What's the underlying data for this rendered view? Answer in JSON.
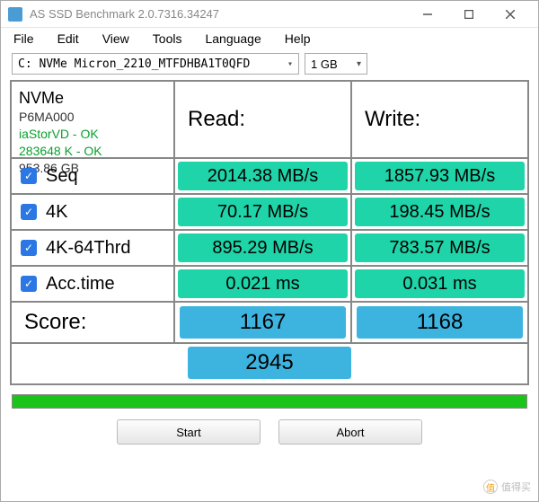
{
  "window": {
    "title": "AS SSD Benchmark 2.0.7316.34247"
  },
  "menu": {
    "file": "File",
    "edit": "Edit",
    "view": "View",
    "tools": "Tools",
    "language": "Language",
    "help": "Help"
  },
  "selectors": {
    "drive": "C: NVMe Micron_2210_MTFDHBA1T0QFD",
    "size": "1 GB"
  },
  "info": {
    "bus": "NVMe",
    "model": "P6MA000",
    "driver": "iaStorVD - OK",
    "align": "283648 K - OK",
    "capacity": "953.86 GB"
  },
  "headers": {
    "read": "Read:",
    "write": "Write:"
  },
  "tests": {
    "seq": {
      "label": "Seq",
      "read": "2014.38 MB/s",
      "write": "1857.93 MB/s"
    },
    "fourk": {
      "label": "4K",
      "read": "70.17 MB/s",
      "write": "198.45 MB/s"
    },
    "fourk64": {
      "label": "4K-64Thrd",
      "read": "895.29 MB/s",
      "write": "783.57 MB/s"
    },
    "acc": {
      "label": "Acc.time",
      "read": "0.021 ms",
      "write": "0.031 ms"
    }
  },
  "score": {
    "label": "Score:",
    "read": "1167",
    "write": "1168",
    "total": "2945"
  },
  "buttons": {
    "start": "Start",
    "abort": "Abort"
  },
  "watermark": "值得买"
}
